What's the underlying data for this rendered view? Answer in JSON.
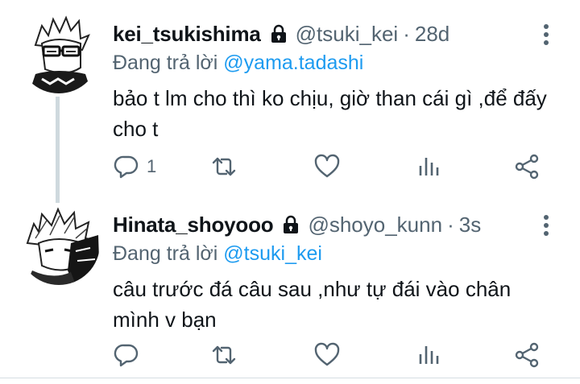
{
  "tweets": [
    {
      "display_name": "kei_tsukishima",
      "handle": "@tsuki_kei",
      "separator": "·",
      "time": "28d",
      "replying_prefix": "Đang trả lời ",
      "replying_to": "@yama.tadashi",
      "text": "bảo t lm cho thì ko chịu, giờ than cái gì ,để đấy cho t",
      "reply_count": "1",
      "retweet_count": "",
      "like_count": ""
    },
    {
      "display_name": "Hinata_shoyooo",
      "handle": "@shoyo_kunn",
      "separator": "·",
      "time": "3s",
      "replying_prefix": "Đang trả lời ",
      "replying_to": "@tsuki_kei",
      "text": "câu trước đá câu sau ,như tự đái vào chân mình v bạn",
      "reply_count": "",
      "retweet_count": "",
      "like_count": ""
    }
  ],
  "icons": {
    "lock": "lock-icon",
    "more": "more-vertical-icon",
    "reply": "reply-icon",
    "retweet": "retweet-icon",
    "like": "heart-icon",
    "stats": "bar-chart-icon",
    "share": "share-icon"
  },
  "colors": {
    "text_primary": "#0f1419",
    "text_secondary": "#536471",
    "mention": "#1d9bf0",
    "thread_line": "#cfd9de"
  }
}
